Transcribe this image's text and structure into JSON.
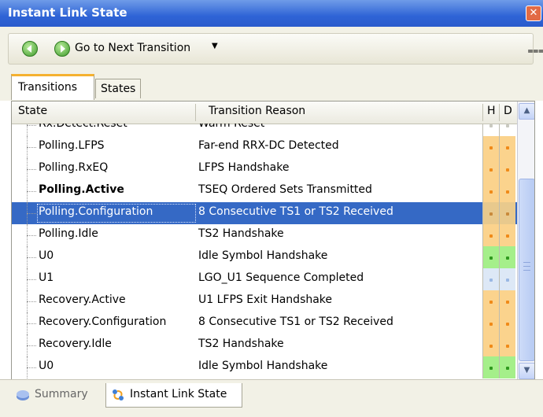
{
  "window": {
    "title": "Instant Link State",
    "close_glyph": "✕"
  },
  "toolbar": {
    "back_icon": "back-circle-icon",
    "next_icon": "next-circle-icon",
    "next_label": "Go to Next Transition",
    "dropdown_glyph": "▼"
  },
  "tabs": [
    {
      "label": "Transitions",
      "active": true
    },
    {
      "label": "States",
      "active": false
    }
  ],
  "grid": {
    "headers": {
      "state": "State",
      "reason": "Transition Reason",
      "h": "H",
      "d": "D"
    },
    "rows": [
      {
        "state": "Rx.Detect.Reset",
        "reason": "Warm Reset",
        "h": "gray",
        "d": "gray",
        "bold": false,
        "selected": false
      },
      {
        "state": "Polling.LFPS",
        "reason": "Far-end RRX-DC Detected",
        "h": "orange",
        "d": "orange",
        "bold": false,
        "selected": false
      },
      {
        "state": "Polling.RxEQ",
        "reason": "LFPS Handshake",
        "h": "orange",
        "d": "orange",
        "bold": false,
        "selected": false
      },
      {
        "state": "Polling.Active",
        "reason": "TSEQ Ordered Sets Transmitted",
        "h": "orange",
        "d": "orange",
        "bold": true,
        "selected": false
      },
      {
        "state": "Polling.Configuration",
        "reason": "8 Consecutive TS1 or TS2 Received",
        "h": "orange",
        "d": "orange",
        "bold": false,
        "selected": true
      },
      {
        "state": "Polling.Idle",
        "reason": "TS2 Handshake",
        "h": "orange",
        "d": "orange",
        "bold": false,
        "selected": false
      },
      {
        "state": "U0",
        "reason": "Idle Symbol Handshake",
        "h": "green",
        "d": "green",
        "bold": false,
        "selected": false
      },
      {
        "state": "U1",
        "reason": "LGO_U1 Sequence Completed",
        "h": "blue",
        "d": "blue",
        "bold": false,
        "selected": false
      },
      {
        "state": "Recovery.Active",
        "reason": "U1 LFPS Exit Handshake",
        "h": "orange",
        "d": "orange",
        "bold": false,
        "selected": false
      },
      {
        "state": "Recovery.Configuration",
        "reason": "8 Consecutive TS1 or TS2 Received",
        "h": "orange",
        "d": "orange",
        "bold": false,
        "selected": false
      },
      {
        "state": "Recovery.Idle",
        "reason": "TS2 Handshake",
        "h": "orange",
        "d": "orange",
        "bold": false,
        "selected": false
      },
      {
        "state": "U0",
        "reason": "Idle Symbol Handshake",
        "h": "green",
        "d": "green",
        "bold": false,
        "selected": false
      }
    ]
  },
  "bottom_tabs": [
    {
      "label": "Summary",
      "icon": "summary-icon",
      "active": false
    },
    {
      "label": "Instant Link State",
      "icon": "instant-link-state-icon",
      "active": true
    }
  ],
  "colors": {
    "titlebar": "#2f64d6",
    "selection": "#3569c5",
    "orange": "#fbd38d",
    "green": "#a5ef8a",
    "blue": "#dde8f6"
  }
}
